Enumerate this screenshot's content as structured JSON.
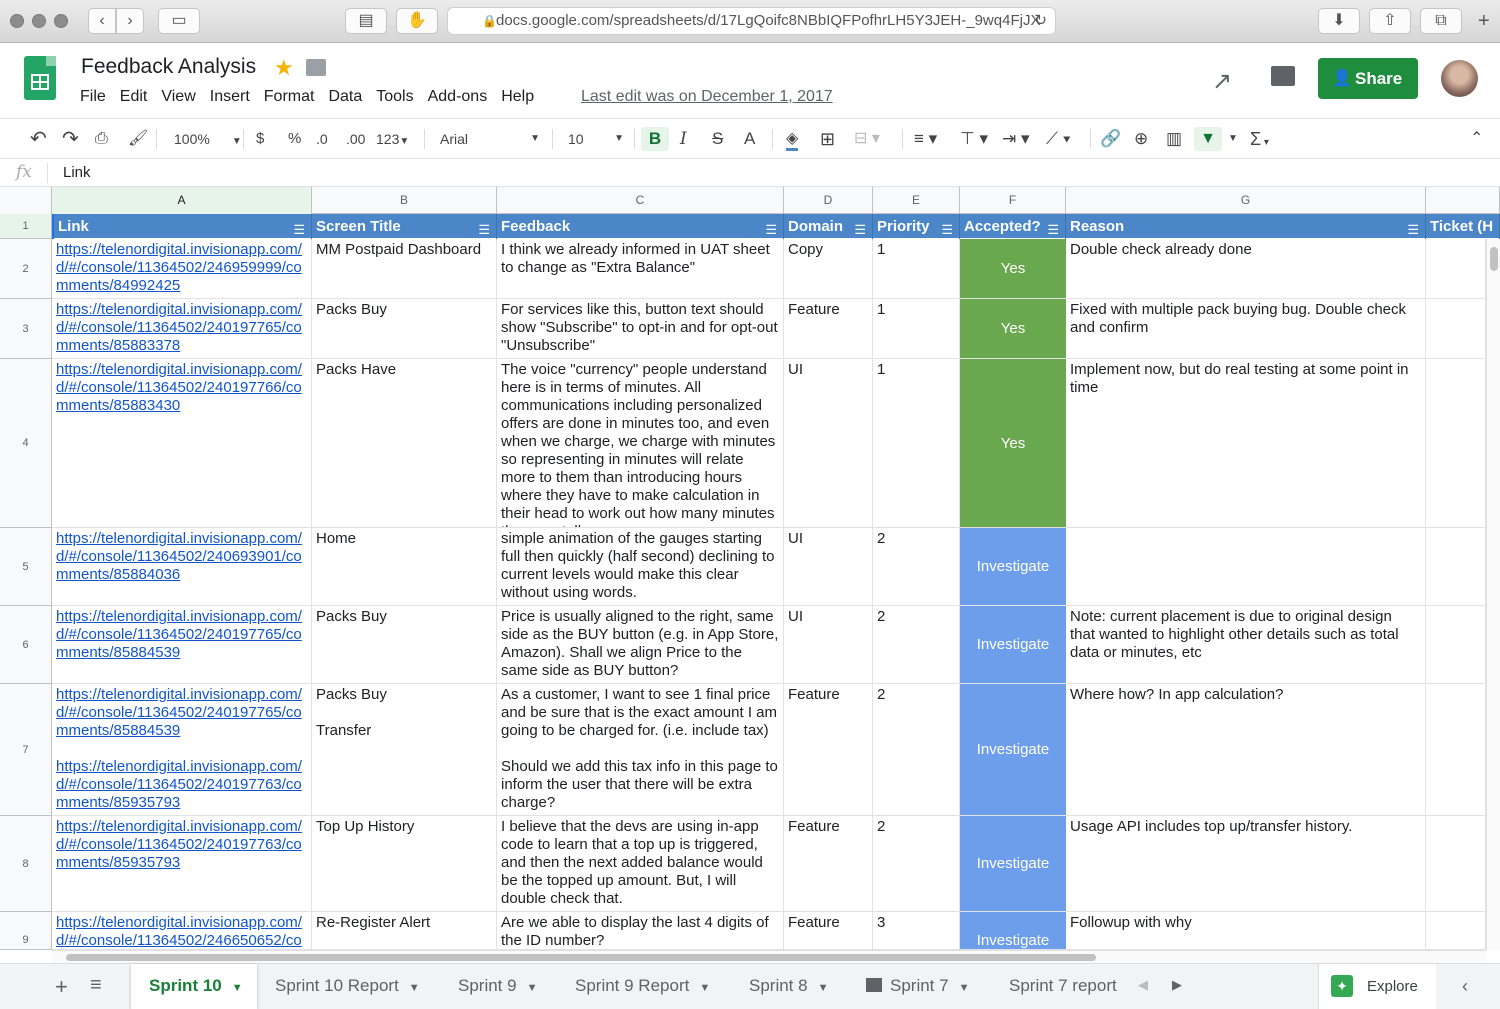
{
  "browser": {
    "url": "docs.google.com/spreadsheets/d/17LgQoifc8NBbIQFPofhrLH5Y3JEH-_9wq4FjJX",
    "lock_icon": "lock-icon",
    "reload_icon": "reload-icon"
  },
  "doc": {
    "title": "Feedback Analysis",
    "last_edit": "Last edit was on December 1, 2017",
    "share_label": "Share"
  },
  "menu": [
    "File",
    "Edit",
    "View",
    "Insert",
    "Format",
    "Data",
    "Tools",
    "Add-ons",
    "Help"
  ],
  "toolbar": {
    "zoom": "100%",
    "currency": "$",
    "percent": "%",
    "dec_less": ".0",
    "dec_more": ".00",
    "number_format": "123",
    "font": "Arial",
    "font_size": "10",
    "bold": "B",
    "italic": "I",
    "strike": "S",
    "text_color": "A",
    "sum": "Σ"
  },
  "formula_bar": {
    "fx": "fx",
    "value": "Link"
  },
  "columns": [
    "A",
    "B",
    "C",
    "D",
    "E",
    "F",
    "G"
  ],
  "header_row": {
    "row_number": "1",
    "labels": [
      "Link",
      "Screen Title",
      "Feedback",
      "Domain",
      "Priority",
      "Accepted?",
      "Reason",
      "Ticket (H"
    ]
  },
  "rows": [
    {
      "num": "2",
      "link": "https://telenordigital.invisionapp.com/d/#/console/11364502/246959999/comments/84992425",
      "title": "MM Postpaid Dashboard",
      "feedback": "I think we already informed in UAT sheet to change as \"Extra Balance\"",
      "domain": "Copy",
      "priority": "1",
      "accepted": "Yes",
      "reason": "Double check already done"
    },
    {
      "num": "3",
      "link": "https://telenordigital.invisionapp.com/d/#/console/11364502/240197765/comments/85883378",
      "title": "Packs Buy",
      "feedback": "For services like this, button text should show \"Subscribe\" to opt-in and for opt-out \"Unsubscribe\"",
      "domain": "Feature",
      "priority": "1",
      "accepted": "Yes",
      "reason": "Fixed with multiple pack buying bug. Double check and confirm"
    },
    {
      "num": "4",
      "link": "https://telenordigital.invisionapp.com/d/#/console/11364502/240197766/comments/85883430",
      "title": "Packs Have",
      "feedback": "The voice \"currency\" people understand here is in terms of minutes. All communications including personalized offers are done in minutes too, and even when we charge, we charge with minutes so representing in minutes will relate more to them than introducing hours where they have to make calculation in their head to work out how many minutes they can talk.",
      "domain": "UI",
      "priority": "1",
      "accepted": "Yes",
      "reason": "Implement now, but do real testing at some point in time"
    },
    {
      "num": "5",
      "link": "https://telenordigital.invisionapp.com/d/#/console/11364502/240693901/comments/85884036",
      "title": "Home",
      "feedback": "simple animation of the gauges starting full then quickly (half second) declining to current levels would make this clear without using words.",
      "domain": "UI",
      "priority": "2",
      "accepted": "Investigate",
      "reason": ""
    },
    {
      "num": "6",
      "link": "https://telenordigital.invisionapp.com/d/#/console/11364502/240197765/comments/85884539",
      "title": "Packs Buy",
      "feedback": "Price is usually aligned to the right, same side as the BUY button (e.g. in App Store, Amazon). Shall we align Price to the same side as BUY button?",
      "domain": "UI",
      "priority": "2",
      "accepted": "Investigate",
      "reason": "Note: current placement is due to original design that wanted to highlight other details such as total data or minutes, etc"
    },
    {
      "num": "7",
      "link": "https://telenordigital.invisionapp.com/d/#/console/11364502/240197765/comments/85884539",
      "link2": "https://telenordigital.invisionapp.com/d/#/console/11364502/240197763/comments/85935793",
      "title": "Packs Buy",
      "title2": "Transfer",
      "feedback": "As a customer, I want to see 1 final price and be sure that is the exact amount I am going to be charged for. (i.e. include tax)",
      "feedback2": "Should we add this tax info in this page to inform the user that there will be extra charge?",
      "domain": "Feature",
      "priority": "2",
      "accepted": "Investigate",
      "reason": "Where how? In app calculation?"
    },
    {
      "num": "8",
      "link": "https://telenordigital.invisionapp.com/d/#/console/11364502/240197763/comments/85935793",
      "title": "Top Up History",
      "feedback": "I believe that the devs are using in-app code to learn that a top up is triggered, and then the next added balance would be the topped up amount. But, I will double check that.",
      "domain": "Feature",
      "priority": "2",
      "accepted": "Investigate",
      "reason": "Usage API includes top up/transfer history."
    },
    {
      "num": "9",
      "link": "https://telenordigital.invisionapp.com/d/#/console/11364502/246650652/com",
      "title": "Re-Register Alert",
      "feedback": "Are we able to display the last 4 digits of the ID number?",
      "domain": "Feature",
      "priority": "3",
      "accepted": "Investigate",
      "reason": "Followup with why"
    }
  ],
  "colors": {
    "header_blue": "#4a86c8",
    "yes_green": "#6aa84f",
    "investigate_blue": "#6d9eeb",
    "share_green": "#1e8e3e"
  },
  "sheet_tabs": [
    "Sprint 10",
    "Sprint 10 Report",
    "Sprint 9",
    "Sprint 9 Report",
    "Sprint 8",
    "Sprint 7",
    "Sprint 7 report"
  ],
  "explore_label": "Explore"
}
